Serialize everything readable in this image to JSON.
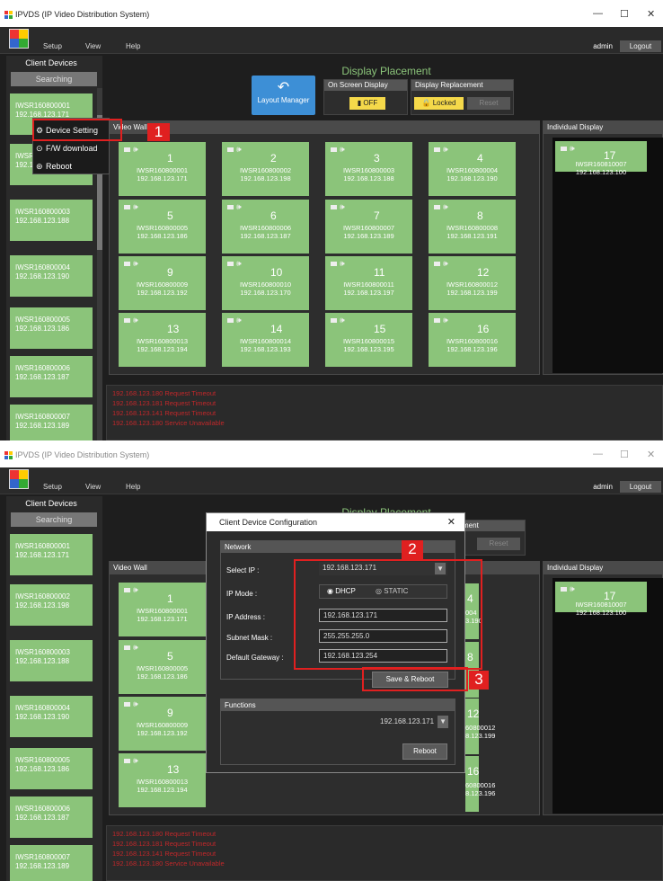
{
  "app": {
    "title": "IPVDS (IP Video Distribution System)"
  },
  "menu": {
    "setup": "Setup",
    "view": "View",
    "help": "Help",
    "user": "admin",
    "logout": "Logout"
  },
  "sidebar": {
    "title": "Client Devices",
    "searching": "Searching",
    "devices": [
      {
        "name": "IWSR160800001",
        "ip": "192.168.123.171"
      },
      {
        "name": "IWSR160800002",
        "ip": "192.168.123.198"
      },
      {
        "name": "IWSR160800003",
        "ip": "192.168.123.188"
      },
      {
        "name": "IWSR160800004",
        "ip": "192.168.123.190"
      },
      {
        "name": "IWSR160800005",
        "ip": "192.168.123.186"
      },
      {
        "name": "IWSR160800006",
        "ip": "192.168.123.187"
      },
      {
        "name": "IWSR160800007",
        "ip": "192.168.123.189"
      }
    ]
  },
  "display_placement": {
    "title": "Display Placement",
    "layout_manager": "Layout Manager",
    "on_screen_display": {
      "label": "On Screen Display",
      "value": "OFF"
    },
    "display_replacement": {
      "label": "Display Replacement",
      "locked": "Locked",
      "reset": "Reset"
    }
  },
  "video_wall": {
    "title": "Video Wall",
    "tiles": [
      {
        "num": "1",
        "name": "IWSR160800001",
        "ip": "192.168.123.171"
      },
      {
        "num": "2",
        "name": "IWSR160800002",
        "ip": "192.168.123.198"
      },
      {
        "num": "3",
        "name": "IWSR160800003",
        "ip": "192.168.123.188"
      },
      {
        "num": "4",
        "name": "IWSR160800004",
        "ip": "192.168.123.190"
      },
      {
        "num": "5",
        "name": "IWSR160800005",
        "ip": "192.168.123.186"
      },
      {
        "num": "6",
        "name": "IWSR160800006",
        "ip": "192.168.123.187"
      },
      {
        "num": "7",
        "name": "IWSR160800007",
        "ip": "192.168.123.189"
      },
      {
        "num": "8",
        "name": "IWSR160800008",
        "ip": "192.168.123.191"
      },
      {
        "num": "9",
        "name": "IWSR160800009",
        "ip": "192.168.123.192"
      },
      {
        "num": "10",
        "name": "IWSR160800010",
        "ip": "192.168.123.170"
      },
      {
        "num": "11",
        "name": "IWSR160800011",
        "ip": "192.168.123.197"
      },
      {
        "num": "12",
        "name": "IWSR160800012",
        "ip": "192.168.123.199"
      },
      {
        "num": "13",
        "name": "IWSR160800013",
        "ip": "192.168.123.194"
      },
      {
        "num": "14",
        "name": "IWSR160800014",
        "ip": "192.168.123.193"
      },
      {
        "num": "15",
        "name": "IWSR160800015",
        "ip": "192.168.123.195"
      },
      {
        "num": "16",
        "name": "IWSR160800016",
        "ip": "192.168.123.196"
      }
    ]
  },
  "individual_display": {
    "title": "Individual Display",
    "tile": {
      "num": "17",
      "name": "IWSR160810007",
      "ip": "192.168.123.100"
    }
  },
  "log": [
    "192.168.123.180 Request Timeout",
    "192.168.123.181 Request Timeout",
    "192.168.123.141 Request Timeout",
    "192.168.123.180 Service Unavailable"
  ],
  "context_menu": {
    "device_setting": "Device Setting",
    "fw_download": "F/W download",
    "reboot": "Reboot"
  },
  "steps": {
    "one": "1",
    "two": "2",
    "three": "3"
  },
  "dialog": {
    "title": "Client Device Configuration",
    "network": "Network",
    "select_ip_label": "Select IP :",
    "select_ip_value": "192.168.123.171",
    "ip_mode_label": "IP Mode :",
    "dhcp": "DHCP",
    "static": "STATIC",
    "ip_address_label": "IP Address :",
    "ip_address_value": "192.168.123.171",
    "subnet_label": "Subnet Mask :",
    "subnet_value": "255.255.255.0",
    "gateway_label": "Default Gateway :",
    "gateway_value": "192.168.123.254",
    "save_reboot": "Save & Reboot",
    "functions": "Functions",
    "functions_ip": "192.168.123.171",
    "reboot": "Reboot"
  },
  "partials": {
    "ment": "ment",
    "t1": "4",
    "t1b": "60(",
    "t1c": "004",
    "t1d": "6.1",
    "t1e": "3.190",
    "t2": "8",
    "t3": "12",
    "t3b": "60800012",
    "t3c": "8.123.199",
    "t4": "16",
    "t4b": "60800016",
    "t4c": "8.123.196"
  },
  "colors": {
    "tile_green": "#8bc47a",
    "accent_blue": "#3d8fd6",
    "highlight_red": "#e02020",
    "log_red": "#c0282a"
  }
}
